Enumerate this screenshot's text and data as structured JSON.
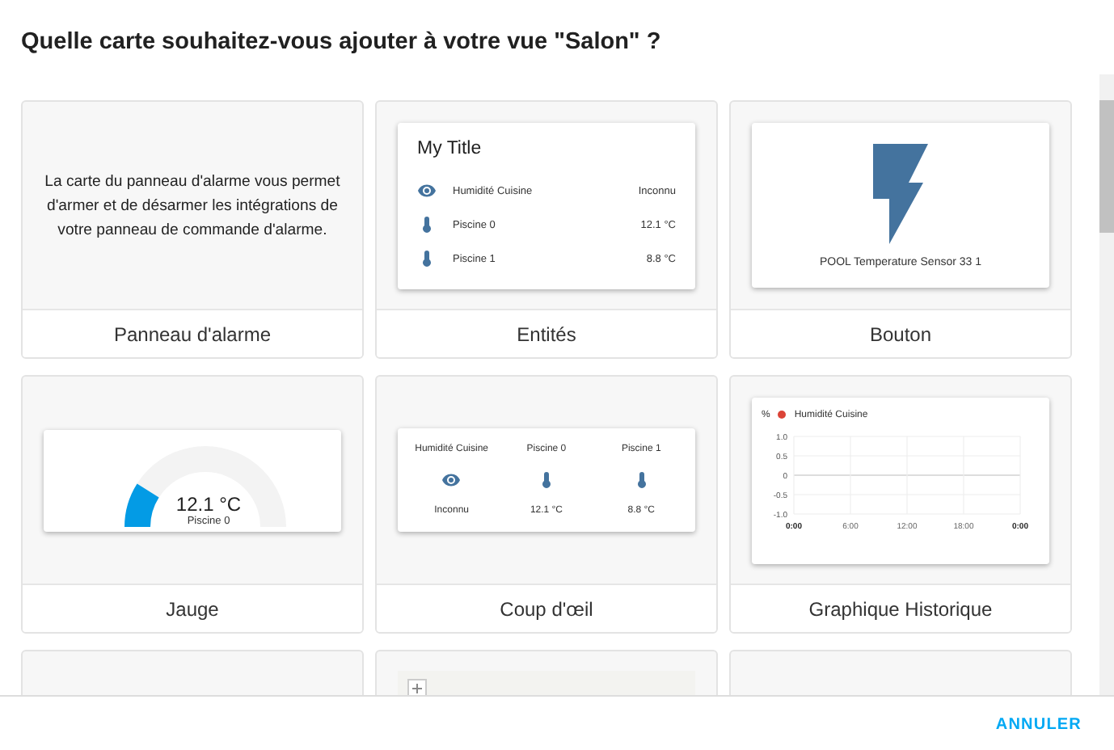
{
  "dialog": {
    "title": "Quelle carte souhaitez-vous ajouter à votre vue \"Salon\" ?"
  },
  "cards": [
    {
      "kind": "text",
      "name": "Panneau d'alarme",
      "description": "La carte du panneau d'alarme vous permet d'armer et de désarmer les intégrations de votre panneau de commande d'alarme."
    },
    {
      "kind": "entities",
      "name": "Entités",
      "title": "My Title",
      "rows": [
        {
          "kind": "eye",
          "label": "Humidité Cuisine",
          "value": "Inconnu"
        },
        {
          "kind": "thermometer",
          "label": "Piscine 0",
          "value": "12.1 °C"
        },
        {
          "kind": "thermometer",
          "label": "Piscine 1",
          "value": "8.8 °C"
        }
      ]
    },
    {
      "kind": "button",
      "name": "Bouton",
      "label": "POOL Temperature Sensor 33 1"
    },
    {
      "kind": "gauge",
      "name": "Jauge",
      "reading": "12.1 °C",
      "label": "Piscine 0",
      "level": 0.18
    },
    {
      "kind": "glance",
      "name": "Coup d'œil",
      "items": [
        {
          "kind": "eye",
          "label": "Humidité Cuisine",
          "value": "Inconnu"
        },
        {
          "kind": "thermometer",
          "label": "Piscine 0",
          "value": "12.1 °C"
        },
        {
          "kind": "thermometer",
          "label": "Piscine 1",
          "value": "8.8 °C"
        }
      ]
    },
    {
      "kind": "history",
      "name": "Graphique Historique",
      "chart_data": {
        "type": "line",
        "grid": true,
        "ylabel": "%",
        "categories": [
          "0:00",
          "6:00",
          "12:00",
          "18:00",
          "0:00"
        ],
        "series": [
          {
            "name": "Humidité Cuisine",
            "color": "#db4437",
            "values": [
              null,
              null,
              null,
              null,
              null
            ]
          }
        ],
        "ylim": [
          -1,
          1
        ],
        "yticks": [
          {
            "value": 1,
            "label": "1.0"
          },
          {
            "value": 0.5,
            "label": "0.5"
          },
          {
            "value": 0,
            "label": "0"
          },
          {
            "value": -0.5,
            "label": "-0.5"
          },
          {
            "value": -1,
            "label": "-1.0"
          }
        ]
      }
    },
    {
      "kind": "blank"
    },
    {
      "kind": "map"
    },
    {
      "kind": "blank"
    }
  ],
  "buttons": [
    "ANNULER"
  ]
}
